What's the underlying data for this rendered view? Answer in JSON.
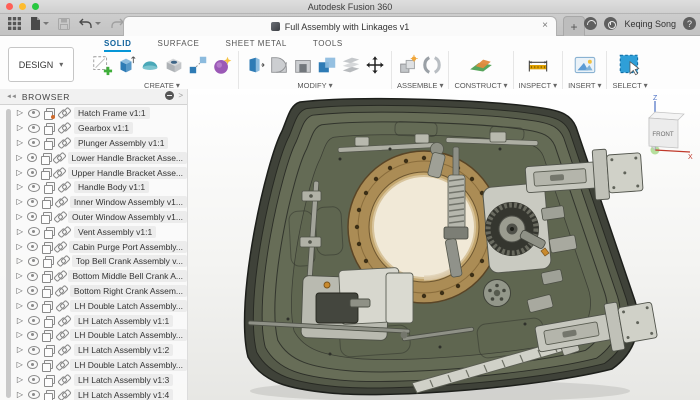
{
  "window": {
    "title": "Autodesk Fusion 360"
  },
  "tab_bar": {
    "tab_title": "Full Assembly with Linkages v1",
    "close_label": "×",
    "new_tab_label": "+",
    "user_name": "Keqing Song",
    "help_label": "?"
  },
  "ribbon": {
    "design_label": "DESIGN",
    "tabs": [
      {
        "label": "SOLID",
        "active": true
      },
      {
        "label": "SURFACE",
        "active": false
      },
      {
        "label": "SHEET METAL",
        "active": false
      },
      {
        "label": "TOOLS",
        "active": false
      }
    ],
    "groups": [
      {
        "label": "CREATE"
      },
      {
        "label": "MODIFY"
      },
      {
        "label": "ASSEMBLE"
      },
      {
        "label": "CONSTRUCT"
      },
      {
        "label": "INSPECT"
      },
      {
        "label": "INSERT"
      },
      {
        "label": "SELECT"
      }
    ]
  },
  "browser": {
    "title": "BROWSER",
    "items": [
      {
        "label": "Hatch Frame v1:1",
        "grounded": true
      },
      {
        "label": "Gearbox v1:1"
      },
      {
        "label": "Plunger Assembly v1:1"
      },
      {
        "label": "Lower Handle Bracket Asse..."
      },
      {
        "label": "Upper Handle Bracket Asse..."
      },
      {
        "label": "Handle Body v1:1"
      },
      {
        "label": "Inner Window Assembly v1..."
      },
      {
        "label": "Outer Window Assembly v1..."
      },
      {
        "label": "Vent Assembly v1:1"
      },
      {
        "label": "Cabin Purge Port Assembly..."
      },
      {
        "label": "Top Bell Crank Assembly v..."
      },
      {
        "label": "Bottom Middle Bell Crank A..."
      },
      {
        "label": "Bottom Right Crank Assem..."
      },
      {
        "label": "LH Double Latch Assembly..."
      },
      {
        "label": "LH Latch Assembly v1:1"
      },
      {
        "label": "LH Double Latch Assembly..."
      },
      {
        "label": "LH Latch Assembly v1:2"
      },
      {
        "label": "LH Double Latch Assembly..."
      },
      {
        "label": "LH Latch Assembly v1:3"
      },
      {
        "label": "LH Latch Assembly v1:4"
      }
    ]
  },
  "viewcube": {
    "front_label": "FRONT",
    "z_label": "Z",
    "x_label": "X"
  },
  "colors": {
    "accent_blue": "#0696d7",
    "hatch_face": "#646b55",
    "hatch_rim": "#3f4239",
    "brass_ring": "#ab8c55",
    "window_glass": "#f1e9d7",
    "linkage_gray": "#c6c7be"
  }
}
